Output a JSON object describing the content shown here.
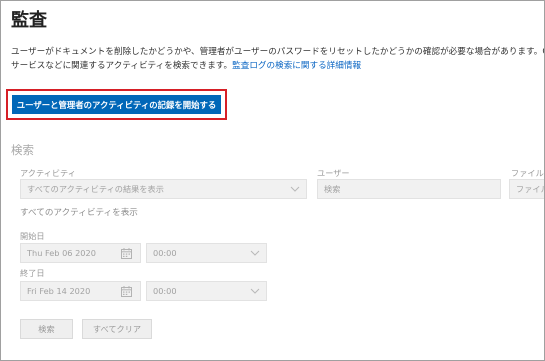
{
  "page": {
    "title": "監査",
    "description_line1": "ユーザーがドキュメントを削除したかどうかや、管理者がユーザーのパスワードをリセットしたかどうかの確認が必要な場合があります。Office 365 の監査",
    "description_line2_prefix": "サービスなどに関連するアクティビティを検索できます。",
    "description_link": "監査ログの検索に関する詳細情報"
  },
  "start_recording": {
    "label": "ユーザーと管理者のアクティビティの記録を開始する"
  },
  "search": {
    "title": "検索",
    "activities": {
      "label": "アクティビティ",
      "value": "すべてのアクティビティの結果を表示",
      "summary": "すべてのアクティビティを表示"
    },
    "users": {
      "label": "ユーザー",
      "placeholder": "検索"
    },
    "files": {
      "label": "ファイル、フ",
      "placeholder": "ファイル、"
    },
    "start_date": {
      "label": "開始日",
      "date": "Thu Feb 06 2020",
      "time": "00:00"
    },
    "end_date": {
      "label": "終了日",
      "date": "Fri Feb 14 2020",
      "time": "00:00"
    },
    "search_button": "検索",
    "clear_button": "すべてクリア"
  },
  "icons": {
    "dropdown": "chevron-down-icon",
    "calendar": "calendar-icon"
  },
  "colors": {
    "accent": "#0067b8",
    "highlight_border": "#d61f26",
    "link": "#0b66c3"
  }
}
